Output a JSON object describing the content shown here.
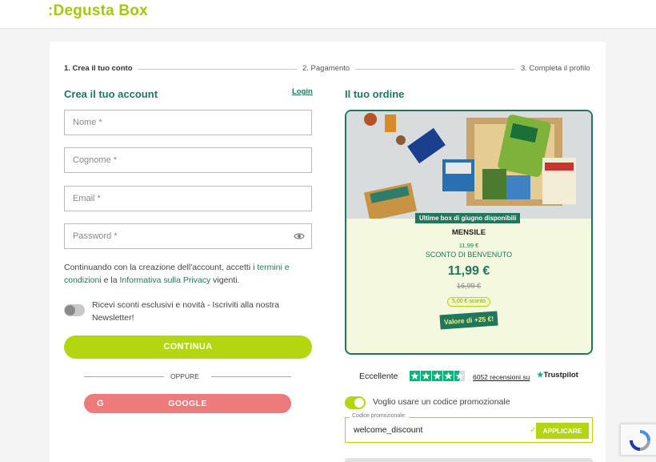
{
  "header": {
    "logo": ":Degusta Box"
  },
  "stepper": {
    "steps": [
      "1. Crea il tuo conto",
      "2. Pagamento",
      "3. Completa il profilo"
    ]
  },
  "account": {
    "title": "Crea il tuo account",
    "login": "Login",
    "fields": {
      "nome": "Nome *",
      "cognome": "Cognome *",
      "email": "Email *",
      "password": "Password *"
    },
    "terms_prefix": "Continuando con la creazione dell'account, accetti i ",
    "terms_link": "termini e condizioni",
    "terms_mid": " e la ",
    "privacy_link": "Informativa sulla Privacy",
    "terms_suffix": " vigenti.",
    "newsletter": "Ricevi sconti esclusivi e novità - Iscriviti alla nostra Newsletter!",
    "newsletter_enabled": false,
    "continue_label": "CONTINUA",
    "or_label": "OPPURE",
    "google_label": "GOOGLE",
    "google_icon": "G"
  },
  "order": {
    "title": "Il tuo ordine",
    "badge": "Ultime box di giugno disponibili",
    "plan": "MENSILE",
    "small_price": "11,99 €",
    "discount_label": "SCONTO DI BENVENUTO",
    "price": "11,99 €",
    "old_price": "16,99 €",
    "saving": "5,00 € sconto",
    "value_tag": "Valore di +25 €!"
  },
  "trustpilot": {
    "rating_label": "Eccellente",
    "stars": 4.5,
    "reviews": "6052 recensioni su",
    "brand": "Trustpilot"
  },
  "promo": {
    "toggle_label": "Voglio usare un codice promozionale",
    "toggle_enabled": true,
    "caption": "Codice promozionale:",
    "value": "welcome_discount",
    "apply_label": "APPLICARE"
  },
  "colors": {
    "brand_green": "#b3d611",
    "dark_green": "#22765b",
    "google_red": "#ee7b7b",
    "trustpilot_green": "#00b67a"
  }
}
